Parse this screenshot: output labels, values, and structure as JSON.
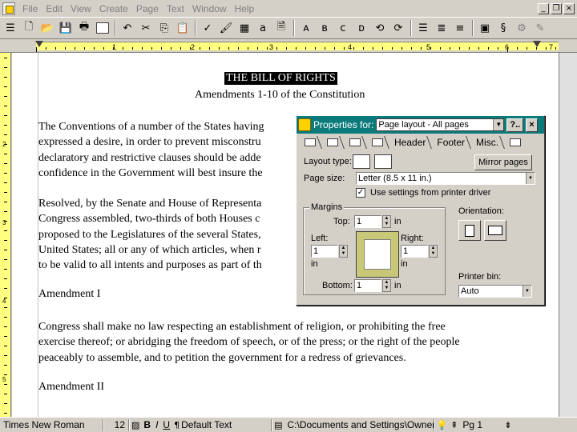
{
  "menu": {
    "items": [
      "File",
      "Edit",
      "View",
      "Create",
      "Page",
      "Text",
      "Window",
      "Help"
    ]
  },
  "ruler": {
    "numbers": [
      "1",
      "2",
      "3",
      "4",
      "5",
      "6",
      "7"
    ],
    "vnumbers": [
      "1",
      "2",
      "3",
      "4",
      "5",
      "6"
    ]
  },
  "document": {
    "title": "THE BILL OF RIGHTS",
    "subtitle": "Amendments 1-10 of the Constitution",
    "para1": [
      "The Conventions of a number of the States having",
      "expressed a desire, in order to prevent misconstru",
      "declaratory and restrictive clauses should be adde",
      "confidence in the Government will best insure the"
    ],
    "para2": [
      "Resolved, by the Senate and House of Representa",
      "Congress assembled, two-thirds of both Houses c",
      "proposed to the Legislatures of the several States,",
      "United States; all or any of which articles, when r",
      "to be valid to all intents and purposes as part of th"
    ],
    "amendment1_heading": "Amendment I",
    "amendment1_text": [
      "Congress shall make no law respecting an establishment of religion, or prohibiting the free",
      "exercise thereof; or abridging the freedom of speech, or of the press; or the right of the people",
      "peaceably to assemble, and to petition the government for a redress of grievances."
    ],
    "amendment2_heading": "Amendment II"
  },
  "dialog": {
    "title_label": "Properties for:",
    "target": "Page layout - All pages",
    "help_button": "?..",
    "close_button": "×",
    "tabs": [
      "Header",
      "Footer",
      "Misc."
    ],
    "layout_type_label": "Layout type:",
    "mirror_pages_button": "Mirror pages",
    "page_size_label": "Page size:",
    "page_size_value": "Letter (8.5 x 11 in.)",
    "use_printer_label": "Use settings from printer driver",
    "use_printer_checked": true,
    "margins_label": "Margins",
    "top_label": "Top:",
    "top_value": "1",
    "left_label": "Left:",
    "left_value": "1",
    "right_label": "Right:",
    "right_value": "1",
    "bottom_label": "Bottom:",
    "bottom_value": "1",
    "unit": "in",
    "orientation_label": "Orientation:",
    "printer_bin_label": "Printer bin:",
    "printer_bin_value": "Auto"
  },
  "status": {
    "font": "Times New Roman",
    "size": "12",
    "bold": "B",
    "italic": "I",
    "underline": "U",
    "style": "Default Text",
    "path": "C:\\Documents and Settings\\Owner\\",
    "page": "Pg 1"
  },
  "colors": {
    "dialog_titlebar": "#0a7a7a",
    "ruler": "#ffff80",
    "chrome": "#d4d0c8"
  }
}
